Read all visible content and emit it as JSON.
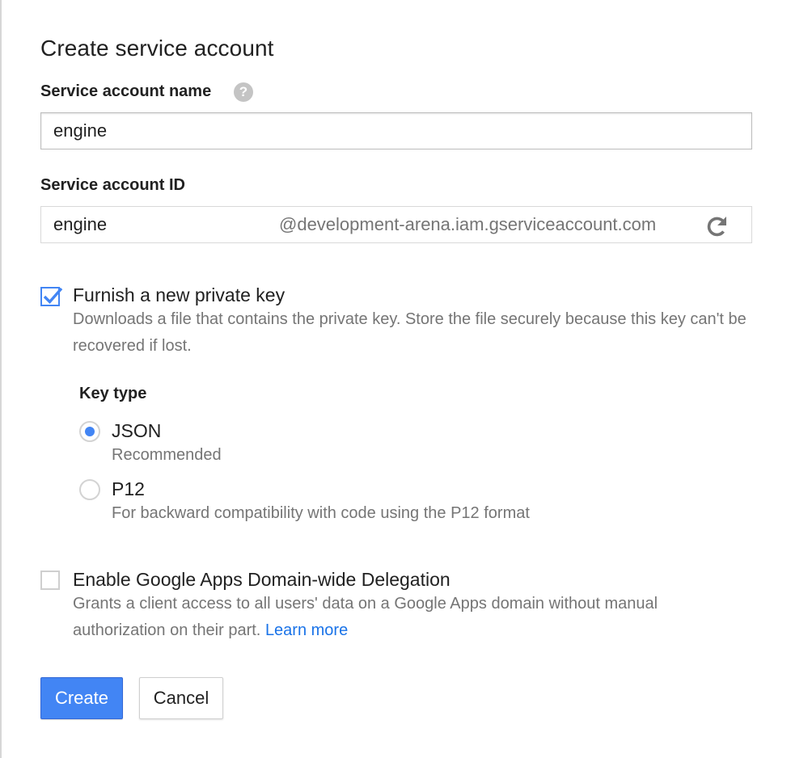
{
  "dialog": {
    "title": "Create service account"
  },
  "name_field": {
    "label": "Service account name",
    "help_icon": "help-icon",
    "value": "engine"
  },
  "id_field": {
    "label": "Service account ID",
    "value": "engine",
    "suffix": "@development-arena.iam.gserviceaccount.com",
    "refresh_icon": "refresh-icon"
  },
  "private_key": {
    "checked": true,
    "title": "Furnish a new private key",
    "description": "Downloads a file that contains the private key. Store the file securely because this key can't be recovered if lost."
  },
  "key_type": {
    "label": "Key type",
    "options": [
      {
        "title": "JSON",
        "description": "Recommended",
        "selected": true
      },
      {
        "title": "P12",
        "description": "For backward compatibility with code using the P12 format",
        "selected": false
      }
    ]
  },
  "delegation": {
    "checked": false,
    "title": "Enable Google Apps Domain-wide Delegation",
    "description": "Grants a client access to all users' data on a Google Apps domain without manual authorization on their part.",
    "link_text": "Learn more"
  },
  "buttons": {
    "create_label": "Create",
    "cancel_label": "Cancel"
  },
  "colors": {
    "accent": "#4285f4",
    "link": "#1a73e8",
    "secondary_text": "#757575"
  }
}
